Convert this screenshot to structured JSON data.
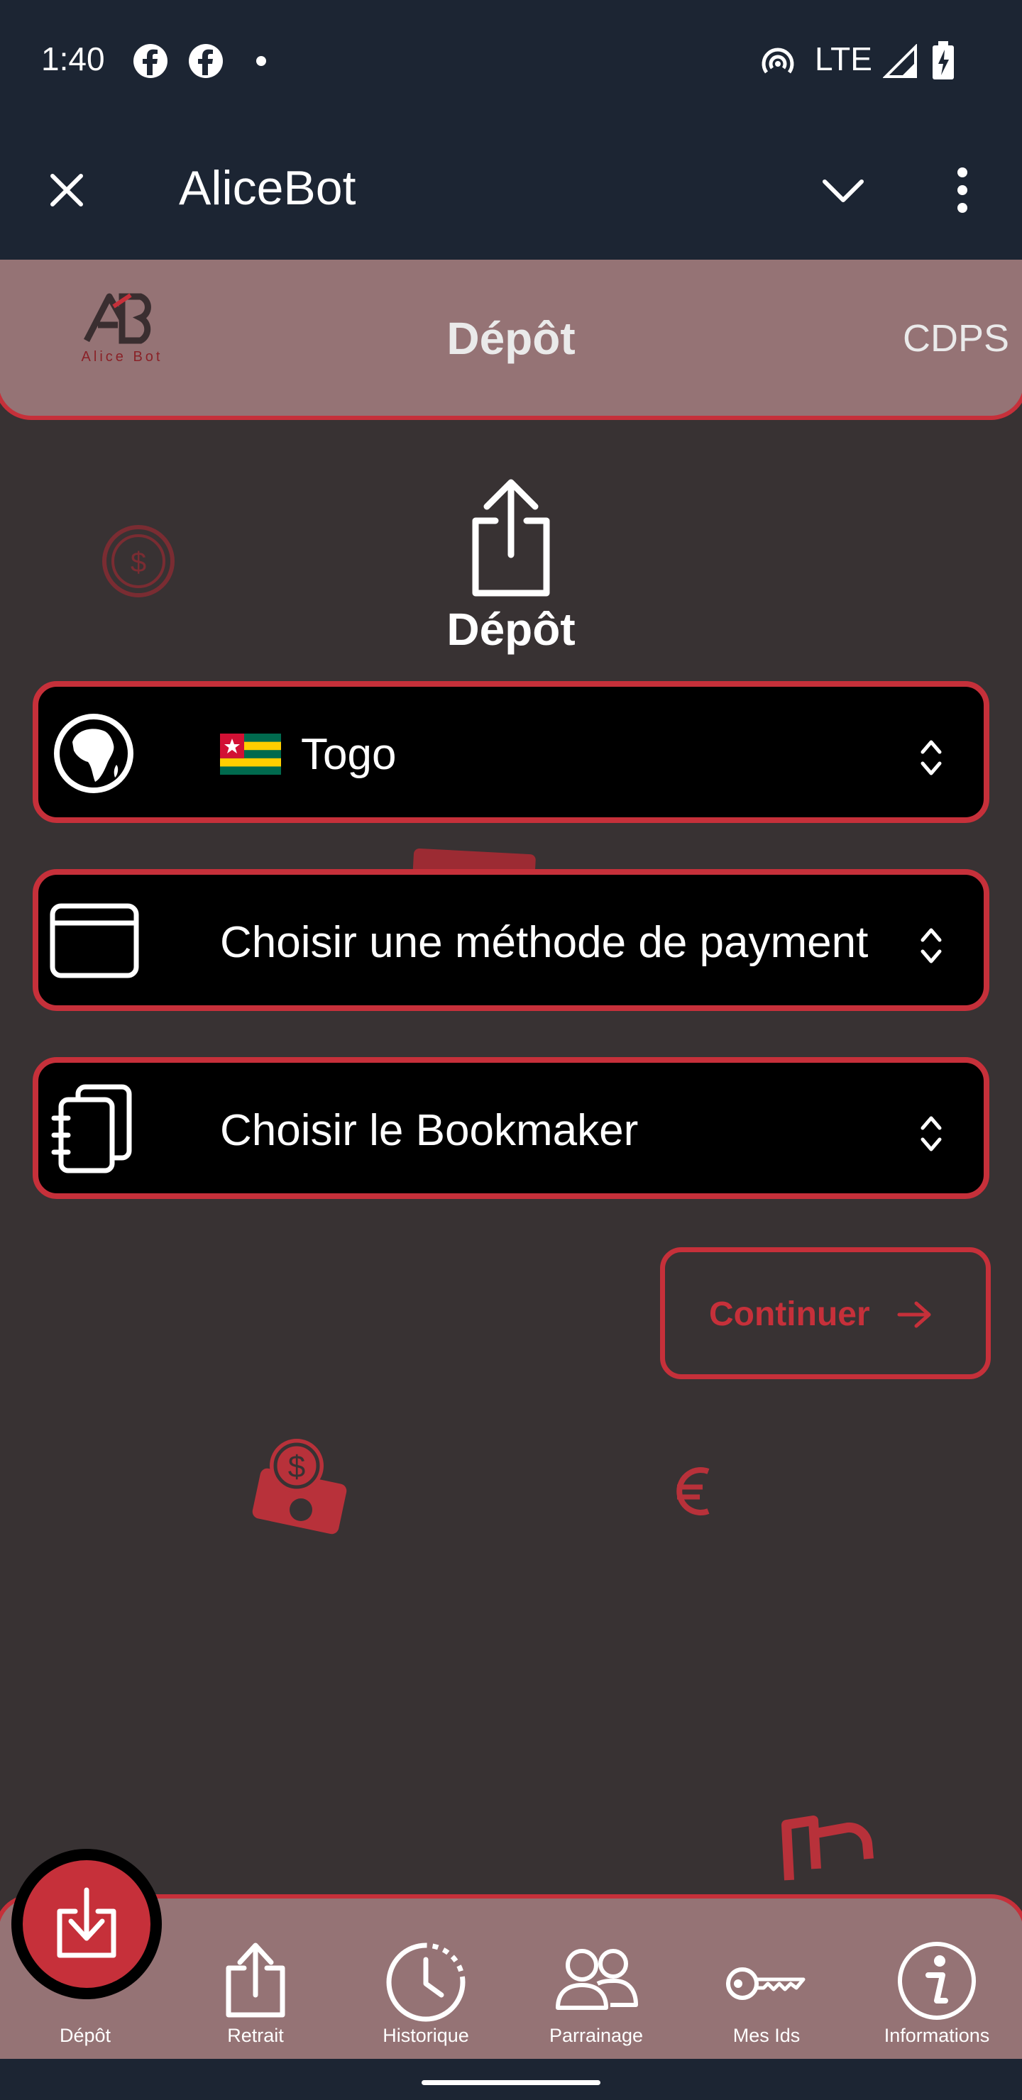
{
  "status_bar": {
    "time": "1:40",
    "network": "LTE",
    "icons": [
      "facebook-icon",
      "facebook-icon",
      "notification-dot-icon",
      "hotspot-icon",
      "signal-icon",
      "battery-charging-icon"
    ]
  },
  "app_bar": {
    "title": "AliceBot",
    "icons": [
      "close-icon",
      "chevron-down-icon",
      "more-vert-icon"
    ]
  },
  "header": {
    "logo_text": "Alice Bot",
    "title": "Dépôt",
    "right_label": "CDPS"
  },
  "hero": {
    "icon": "upload-icon",
    "label": "Dépôt"
  },
  "selectors": [
    {
      "icon": "globe-africa-icon",
      "flag": "togo-flag-icon",
      "value": "Togo"
    },
    {
      "icon": "card-icon",
      "value": "Choisir une méthode de payment"
    },
    {
      "icon": "notebook-icon",
      "value": "Choisir le Bookmaker"
    }
  ],
  "continue_button": {
    "label": "Continuer",
    "icon": "arrow-right-icon"
  },
  "bottom_nav": [
    {
      "label": "Dépôt",
      "icon": "download-icon",
      "active": true
    },
    {
      "label": "Retrait",
      "icon": "upload-icon"
    },
    {
      "label": "Historique",
      "icon": "clock-icon"
    },
    {
      "label": "Parrainage",
      "icon": "people-icon"
    },
    {
      "label": "Mes Ids",
      "icon": "key-icon"
    },
    {
      "label": "Informations",
      "icon": "info-icon"
    }
  ],
  "colors": {
    "dark_bar": "#1c2533",
    "background": "#383233",
    "panel": "#957375",
    "accent_red": "#c6303a",
    "card_bg": "#000000"
  }
}
